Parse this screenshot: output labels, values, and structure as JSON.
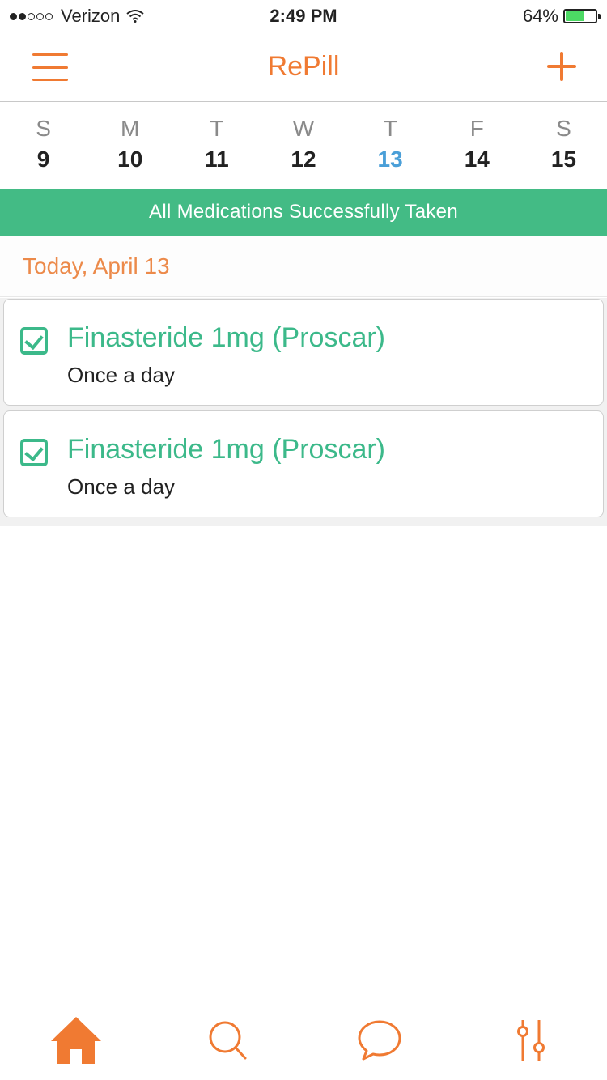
{
  "status_bar": {
    "carrier": "Verizon",
    "time": "2:49 PM",
    "battery": "64%",
    "battery_level": 0.64,
    "signal_bars": 2
  },
  "header": {
    "title": "RePill",
    "menu_icon": "hamburger-menu-icon",
    "add_icon": "plus-icon"
  },
  "week": {
    "days": [
      {
        "letter": "S",
        "number": "9"
      },
      {
        "letter": "M",
        "number": "10"
      },
      {
        "letter": "T",
        "number": "11"
      },
      {
        "letter": "W",
        "number": "12"
      },
      {
        "letter": "T",
        "number": "13",
        "today": true
      },
      {
        "letter": "F",
        "number": "14"
      },
      {
        "letter": "S",
        "number": "15"
      }
    ]
  },
  "banner": {
    "text": "All Medications Successfully Taken",
    "color": "#43bb85"
  },
  "date_header": {
    "text": "Today, April 13"
  },
  "medications": [
    {
      "name": "Finasteride 1mg (Proscar)",
      "frequency": "Once a day",
      "taken": true
    },
    {
      "name": "Finasteride 1mg (Proscar)",
      "frequency": "Once a day",
      "taken": true
    }
  ],
  "tabbar": {
    "tabs": [
      {
        "icon": "home-icon",
        "active": true
      },
      {
        "icon": "search-icon",
        "active": false
      },
      {
        "icon": "chat-bubble-icon",
        "active": false
      },
      {
        "icon": "settings-sliders-icon",
        "active": false
      }
    ]
  },
  "colors": {
    "accent": "#f07a32",
    "success": "#43bb85",
    "today": "#4a9fd8"
  }
}
